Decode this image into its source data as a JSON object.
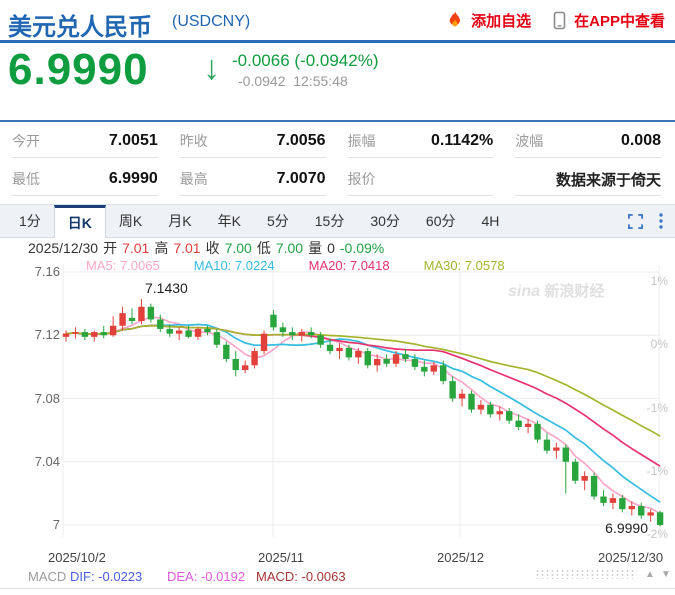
{
  "header": {
    "title": "美元兑人民币",
    "symbol": "(USDCNY)",
    "add_watchlist": "添加自选",
    "view_in_app": "在APP中查看"
  },
  "quote": {
    "price": "6.9990",
    "change": "-0.0066 (-0.0942%)",
    "change_abs": "-0.0942",
    "time": "12:55:48"
  },
  "stats": {
    "rows": [
      [
        {
          "label": "今开",
          "value": "7.0051"
        },
        {
          "label": "昨收",
          "value": "7.0056"
        },
        {
          "label": "振幅",
          "value": "0.1142%"
        },
        {
          "label": "波幅",
          "value": "0.008"
        }
      ],
      [
        {
          "label": "最低",
          "value": "6.9990"
        },
        {
          "label": "最高",
          "value": "7.0070"
        },
        {
          "label": "报价",
          "value": ""
        },
        {
          "label": "",
          "value": "数据来源于倚天"
        }
      ]
    ]
  },
  "tabs": {
    "items": [
      "1分",
      "日K",
      "周K",
      "月K",
      "年K",
      "5分",
      "15分",
      "30分",
      "60分",
      "4H"
    ],
    "active": "日K"
  },
  "ohlc_bar": {
    "date": "2025/12/30",
    "o_label": "开",
    "o": "7.01",
    "h_label": "高",
    "h": "7.01",
    "c_label": "收",
    "c": "7.00",
    "l_label": "低",
    "l": "7.00",
    "v_label": "量",
    "v": "0",
    "pct": "-0.09%"
  },
  "watermark": {
    "brand": "sina",
    "name": "新浪财经"
  },
  "macd_bar": {
    "title": "MACD",
    "dif": "DIF: -0.0223",
    "dea": "DEA: -0.0192",
    "macd": "MACD: -0.0063"
  },
  "colors": {
    "accent_blue": "#2b6cb8",
    "link_red": "#e60012",
    "price_green": "#0f9d3f",
    "candle_up": "#e2403a",
    "candle_down": "#28a53c"
  },
  "chart_data": {
    "type": "candlestick",
    "title": "USDCNY 日K",
    "x_axis_labels": [
      "2025/10/2",
      "2025/11",
      "2025/12",
      "2025/12/30"
    ],
    "y_axis_left": [
      "7.16",
      "7.12",
      "7.08",
      "7.04",
      "7"
    ],
    "y_axis_right": [
      "1%",
      "0%",
      "-1%",
      "-1%",
      "-2%"
    ],
    "y_levels": [
      7.16,
      7.12,
      7.08,
      7.04,
      7.0
    ],
    "ylim": [
      6.985,
      7.17
    ],
    "grid": true,
    "annotations": {
      "high": {
        "text": "7.1430"
      },
      "low": {
        "text": "6.9990"
      }
    },
    "up_color": "#e2403a",
    "down_color": "#28a53c",
    "ma": [
      {
        "period": 5,
        "label": "MA5: 7.0065",
        "color": "#f8a8c8"
      },
      {
        "period": 10,
        "label": "MA10: 7.0224",
        "color": "#35bde0"
      },
      {
        "period": 20,
        "label": "MA20: 7.0418",
        "color": "#e8336e"
      },
      {
        "period": 30,
        "label": "MA30: 7.0578",
        "color": "#a4b52d"
      }
    ],
    "candles": [
      [
        7.119,
        7.123,
        7.116,
        7.121
      ],
      [
        7.121,
        7.125,
        7.118,
        7.122
      ],
      [
        7.122,
        7.124,
        7.117,
        7.119
      ],
      [
        7.119,
        7.123,
        7.116,
        7.122
      ],
      [
        7.122,
        7.126,
        7.118,
        7.12
      ],
      [
        7.12,
        7.132,
        7.119,
        7.126
      ],
      [
        7.126,
        7.138,
        7.123,
        7.134
      ],
      [
        7.131,
        7.137,
        7.127,
        7.129
      ],
      [
        7.129,
        7.143,
        7.127,
        7.138
      ],
      [
        7.138,
        7.14,
        7.128,
        7.13
      ],
      [
        7.13,
        7.133,
        7.122,
        7.124
      ],
      [
        7.124,
        7.127,
        7.119,
        7.121
      ],
      [
        7.121,
        7.125,
        7.117,
        7.123
      ],
      [
        7.123,
        7.126,
        7.118,
        7.119
      ],
      [
        7.119,
        7.125,
        7.117,
        7.124
      ],
      [
        7.124,
        7.126,
        7.12,
        7.122
      ],
      [
        7.122,
        7.124,
        7.112,
        7.114
      ],
      [
        7.114,
        7.116,
        7.103,
        7.105
      ],
      [
        7.105,
        7.11,
        7.094,
        7.098
      ],
      [
        7.098,
        7.104,
        7.096,
        7.101
      ],
      [
        7.101,
        7.112,
        7.099,
        7.11
      ],
      [
        7.11,
        7.123,
        7.108,
        7.121
      ],
      [
        7.133,
        7.136,
        7.123,
        7.125
      ],
      [
        7.125,
        7.128,
        7.119,
        7.122
      ],
      [
        7.122,
        7.125,
        7.117,
        7.12
      ],
      [
        7.12,
        7.124,
        7.116,
        7.122
      ],
      [
        7.122,
        7.125,
        7.118,
        7.12
      ],
      [
        7.12,
        7.122,
        7.112,
        7.114
      ],
      [
        7.114,
        7.118,
        7.108,
        7.11
      ],
      [
        7.11,
        7.115,
        7.105,
        7.112
      ],
      [
        7.112,
        7.114,
        7.104,
        7.106
      ],
      [
        7.106,
        7.112,
        7.102,
        7.11
      ],
      [
        7.11,
        7.112,
        7.099,
        7.101
      ],
      [
        7.101,
        7.108,
        7.097,
        7.105
      ],
      [
        7.105,
        7.108,
        7.1,
        7.102
      ],
      [
        7.102,
        7.11,
        7.1,
        7.108
      ],
      [
        7.108,
        7.111,
        7.103,
        7.105
      ],
      [
        7.105,
        7.108,
        7.098,
        7.1
      ],
      [
        7.1,
        7.104,
        7.094,
        7.097
      ],
      [
        7.097,
        7.103,
        7.095,
        7.101
      ],
      [
        7.101,
        7.104,
        7.089,
        7.091
      ],
      [
        7.091,
        7.094,
        7.078,
        7.08
      ],
      [
        7.08,
        7.086,
        7.075,
        7.083
      ],
      [
        7.083,
        7.085,
        7.071,
        7.073
      ],
      [
        7.073,
        7.079,
        7.07,
        7.076
      ],
      [
        7.076,
        7.078,
        7.068,
        7.07
      ],
      [
        7.07,
        7.075,
        7.066,
        7.072
      ],
      [
        7.072,
        7.074,
        7.064,
        7.066
      ],
      [
        7.066,
        7.07,
        7.06,
        7.062
      ],
      [
        7.062,
        7.067,
        7.058,
        7.064
      ],
      [
        7.064,
        7.066,
        7.052,
        7.054
      ],
      [
        7.054,
        7.058,
        7.045,
        7.047
      ],
      [
        7.047,
        7.052,
        7.042,
        7.049
      ],
      [
        7.049,
        7.051,
        7.02,
        7.04
      ],
      [
        7.04,
        7.042,
        7.026,
        7.028
      ],
      [
        7.028,
        7.034,
        7.022,
        7.031
      ],
      [
        7.031,
        7.033,
        7.016,
        7.018
      ],
      [
        7.018,
        7.022,
        7.012,
        7.014
      ],
      [
        7.014,
        7.02,
        7.01,
        7.017
      ],
      [
        7.017,
        7.019,
        7.008,
        7.01
      ],
      [
        7.01,
        7.015,
        7.006,
        7.012
      ],
      [
        7.012,
        7.014,
        7.004,
        7.006
      ],
      [
        7.006,
        7.01,
        7.002,
        7.008
      ],
      [
        7.008,
        7.009,
        6.999,
        7.0
      ]
    ]
  }
}
